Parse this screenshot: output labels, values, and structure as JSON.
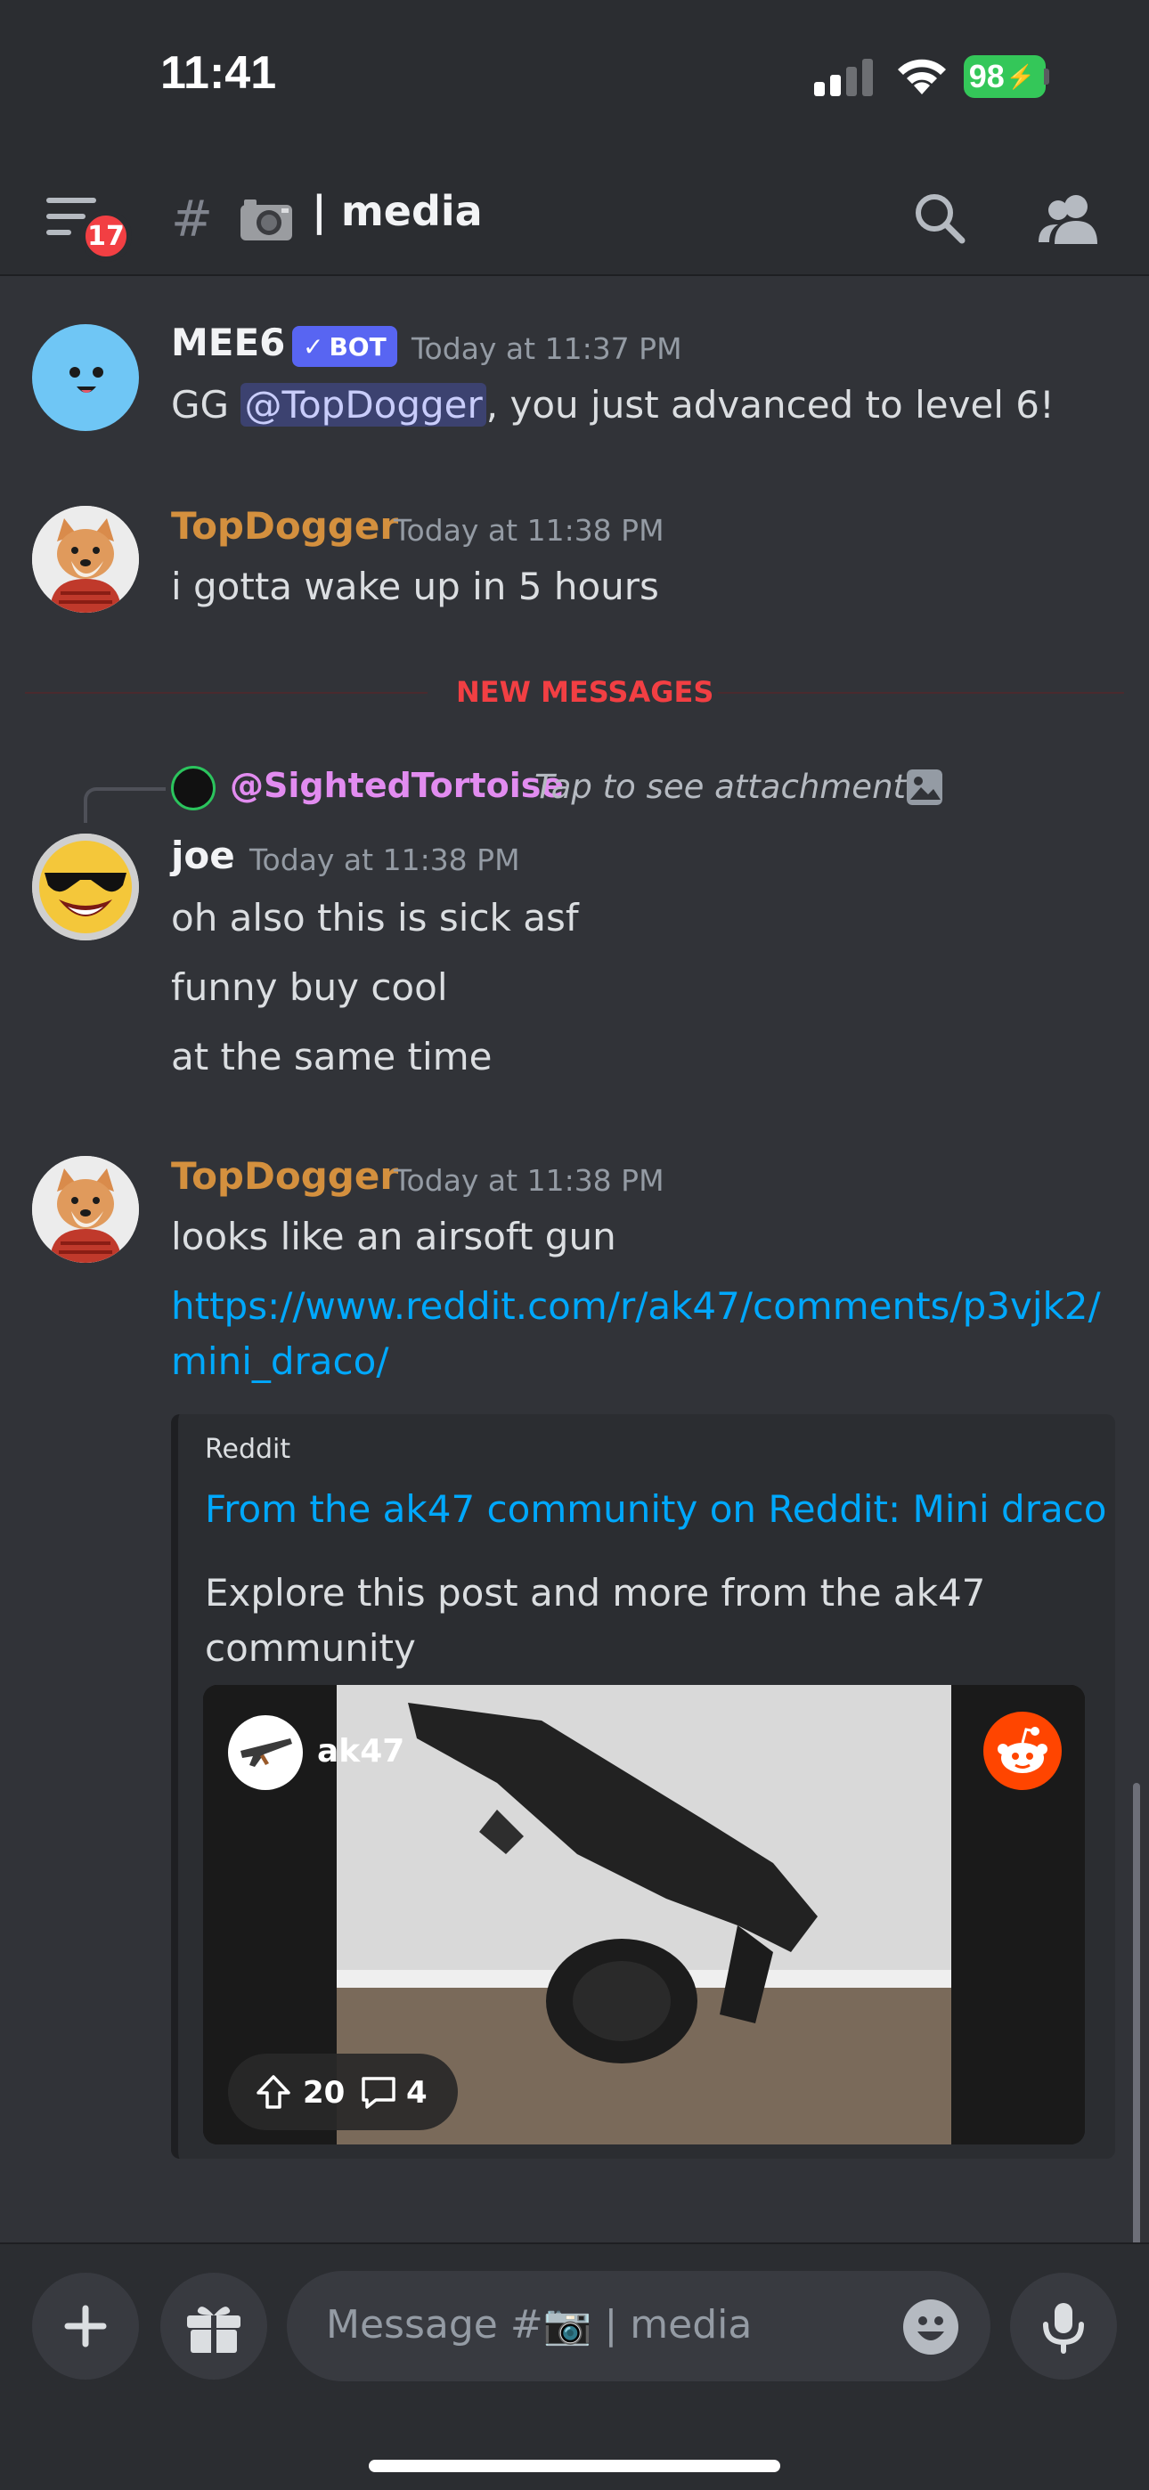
{
  "status": {
    "time": "11:41",
    "battery": "98"
  },
  "header": {
    "badge": "17",
    "channel": "| media"
  },
  "messages": [
    {
      "author": "MEE6",
      "bot_label": "BOT",
      "time": "Today at 11:37 PM",
      "text_before": "GG ",
      "mention": "@TopDogger",
      "text_after": ", you just advanced to level 6!"
    },
    {
      "author": "TopDogger",
      "time": "Today at 11:38 PM",
      "lines": [
        "i gotta wake up in 5 hours"
      ]
    },
    {
      "author": "joe",
      "time": "Today at 11:38 PM",
      "lines": [
        "oh also this is sick asf",
        "funny buy cool",
        "at the same time"
      ]
    },
    {
      "author": "TopDogger",
      "time": "Today at 11:38 PM",
      "lines": [
        "looks like an airsoft gun"
      ],
      "link_lines": [
        "https://www.reddit.com/r/ak47/comments/p3vjk2/",
        "mini_draco/"
      ]
    }
  ],
  "divider": "NEW MESSAGES",
  "reply": {
    "user": "@SightedTortoise",
    "text": "Tap to see attachment"
  },
  "embed": {
    "provider": "Reddit",
    "title": "From the ak47 community on Reddit: Mini draco",
    "description": "Explore this post and more from the ak47 community",
    "subreddit": "ak47",
    "upvotes": "20",
    "comments": "4"
  },
  "composer": {
    "placeholder": "Message #📷 | media"
  },
  "colors": {
    "username_orange": "#d4903e",
    "link": "#00a8fc",
    "new_messages": "#f23f43",
    "mee6_avatar": "#6fc6f5",
    "background": "#313338"
  }
}
